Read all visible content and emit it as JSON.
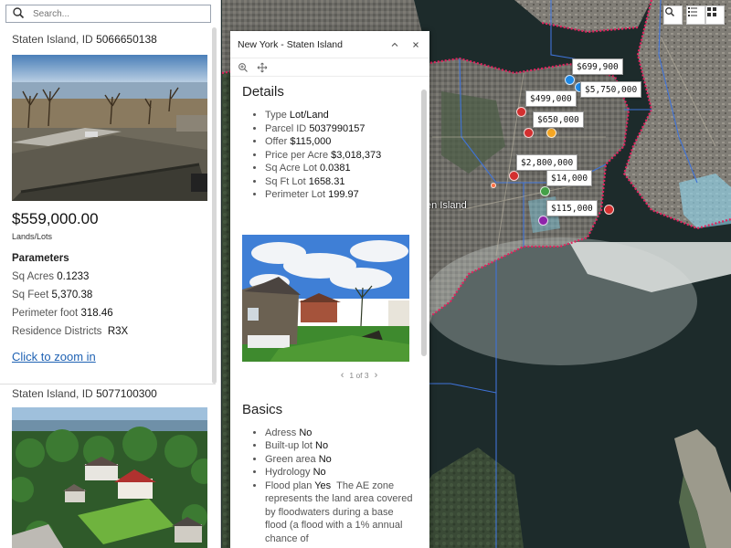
{
  "search": {
    "placeholder": "Search..."
  },
  "listings": [
    {
      "title_prefix": "Staten Island, ID",
      "id": "5066650138",
      "price": "$559,000.00",
      "category": "Lands/Lots",
      "params_title": "Parameters",
      "params": [
        {
          "label": "Sq Acres",
          "value": "0.1233"
        },
        {
          "label": "Sq Feet",
          "value": "5,370.38"
        },
        {
          "label": "Perimeter foot",
          "value": "318.46"
        },
        {
          "label": "Residence Districts",
          "value": "R3X"
        }
      ],
      "zoom_link": "Click to zoom in"
    },
    {
      "title_prefix": "Staten Island, ID",
      "id": "5077100300"
    }
  ],
  "popup": {
    "title": "New York - Staten Island",
    "details_title": "Details",
    "details": [
      {
        "label": "Type",
        "value": "Lot/Land"
      },
      {
        "label": "Parcel ID",
        "value": "5037990157"
      },
      {
        "label": "Offer",
        "value": "$115,000"
      },
      {
        "label": "Price per Acre",
        "value": "$3,018,373"
      },
      {
        "label": "Sq Acre Lot",
        "value": "0.0381"
      },
      {
        "label": "Sq Ft Lot",
        "value": "1658.31"
      },
      {
        "label": "Perimeter Lot",
        "value": "199.97"
      }
    ],
    "pager": "1 of 3",
    "basics_title": "Basics",
    "basics": [
      {
        "label": "Adress",
        "value": "No"
      },
      {
        "label": "Built-up lot",
        "value": "No"
      },
      {
        "label": "Green area",
        "value": "No"
      },
      {
        "label": "Hydrology",
        "value": "No"
      },
      {
        "label": "Flood plan",
        "value": "Yes",
        "note": "The AE zone represents the land area covered by floodwaters during a base flood (a flood with a 1% annual chance of"
      }
    ]
  },
  "map": {
    "place_label": "ten Island",
    "price_tags": [
      "$699,900",
      "$5,750,000",
      "$499,000",
      "$650,000",
      "$2,800,000",
      "$14,000",
      "$115,000"
    ],
    "pin_colors": [
      "#1e88e5",
      "#d32f2f",
      "#f5a623",
      "#43a047",
      "#8e24aa",
      "#ff7043"
    ]
  },
  "colors": {
    "link": "#1f62b3",
    "flood_zone": "#e0245e",
    "boundary": "#3f73d9"
  }
}
